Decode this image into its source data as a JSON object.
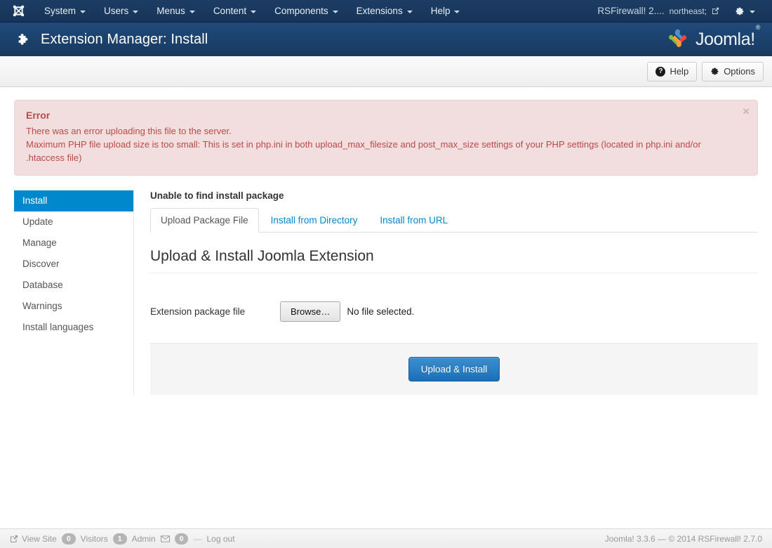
{
  "topbar": {
    "brand_icon": "joomla-mark-icon",
    "menu": [
      {
        "label": "System",
        "caret": true
      },
      {
        "label": "Users",
        "caret": true
      },
      {
        "label": "Menus",
        "caret": true
      },
      {
        "label": "Content",
        "caret": true
      },
      {
        "label": "Components",
        "caret": true
      },
      {
        "label": "Extensions",
        "caret": true
      },
      {
        "label": "Help",
        "caret": true
      }
    ],
    "user_label": "RSFirewall! 2....",
    "user_icon": "external-link-icon",
    "settings_icon": "gear-icon"
  },
  "header": {
    "icon": "puzzle-piece-icon",
    "title": "Extension Manager: Install",
    "logo_text": "Joomla!",
    "logo_sup": "®"
  },
  "toolbar": {
    "help_label": "Help",
    "help_icon": "question-circle-icon",
    "options_label": "Options",
    "options_icon": "gear-icon"
  },
  "alert": {
    "type": "error",
    "title": "Error",
    "lines": [
      "There was an error uploading this file to the server.",
      "Maximum PHP file upload size is too small: This is set in php.ini in both upload_max_filesize and post_max_size settings of your PHP settings (located in php.ini and/or .htaccess file)"
    ],
    "close_icon": "close-icon",
    "close_label": "×",
    "bg_color": "#f2dede",
    "text_color": "#b94a48"
  },
  "sidebar": {
    "items": [
      {
        "label": "Install",
        "active": true
      },
      {
        "label": "Update",
        "active": false
      },
      {
        "label": "Manage",
        "active": false
      },
      {
        "label": "Discover",
        "active": false
      },
      {
        "label": "Database",
        "active": false
      },
      {
        "label": "Warnings",
        "active": false
      },
      {
        "label": "Install languages",
        "active": false
      }
    ],
    "active_color": "#0088cc"
  },
  "panel": {
    "heading": "Unable to find install package",
    "tabs": [
      {
        "label": "Upload Package File",
        "active": true
      },
      {
        "label": "Install from Directory",
        "active": false
      },
      {
        "label": "Install from URL",
        "active": false
      }
    ],
    "form_title": "Upload & Install Joomla Extension",
    "field_label": "Extension package file",
    "browse_label": "Browse…",
    "file_status": "No file selected.",
    "submit_label": "Upload & Install"
  },
  "statusbar": {
    "view_site_label": "View Site",
    "view_site_icon": "external-link-icon",
    "visitors_count": "0",
    "visitors_label": "Visitors",
    "admin_count": "1",
    "admin_label": "Admin",
    "messages_icon": "envelope-icon",
    "messages_count": "0",
    "separator": "—",
    "logout_label": "Log out",
    "version": "Joomla! 3.3.6  —  © 2014 RSFirewall! 2.7.0"
  }
}
